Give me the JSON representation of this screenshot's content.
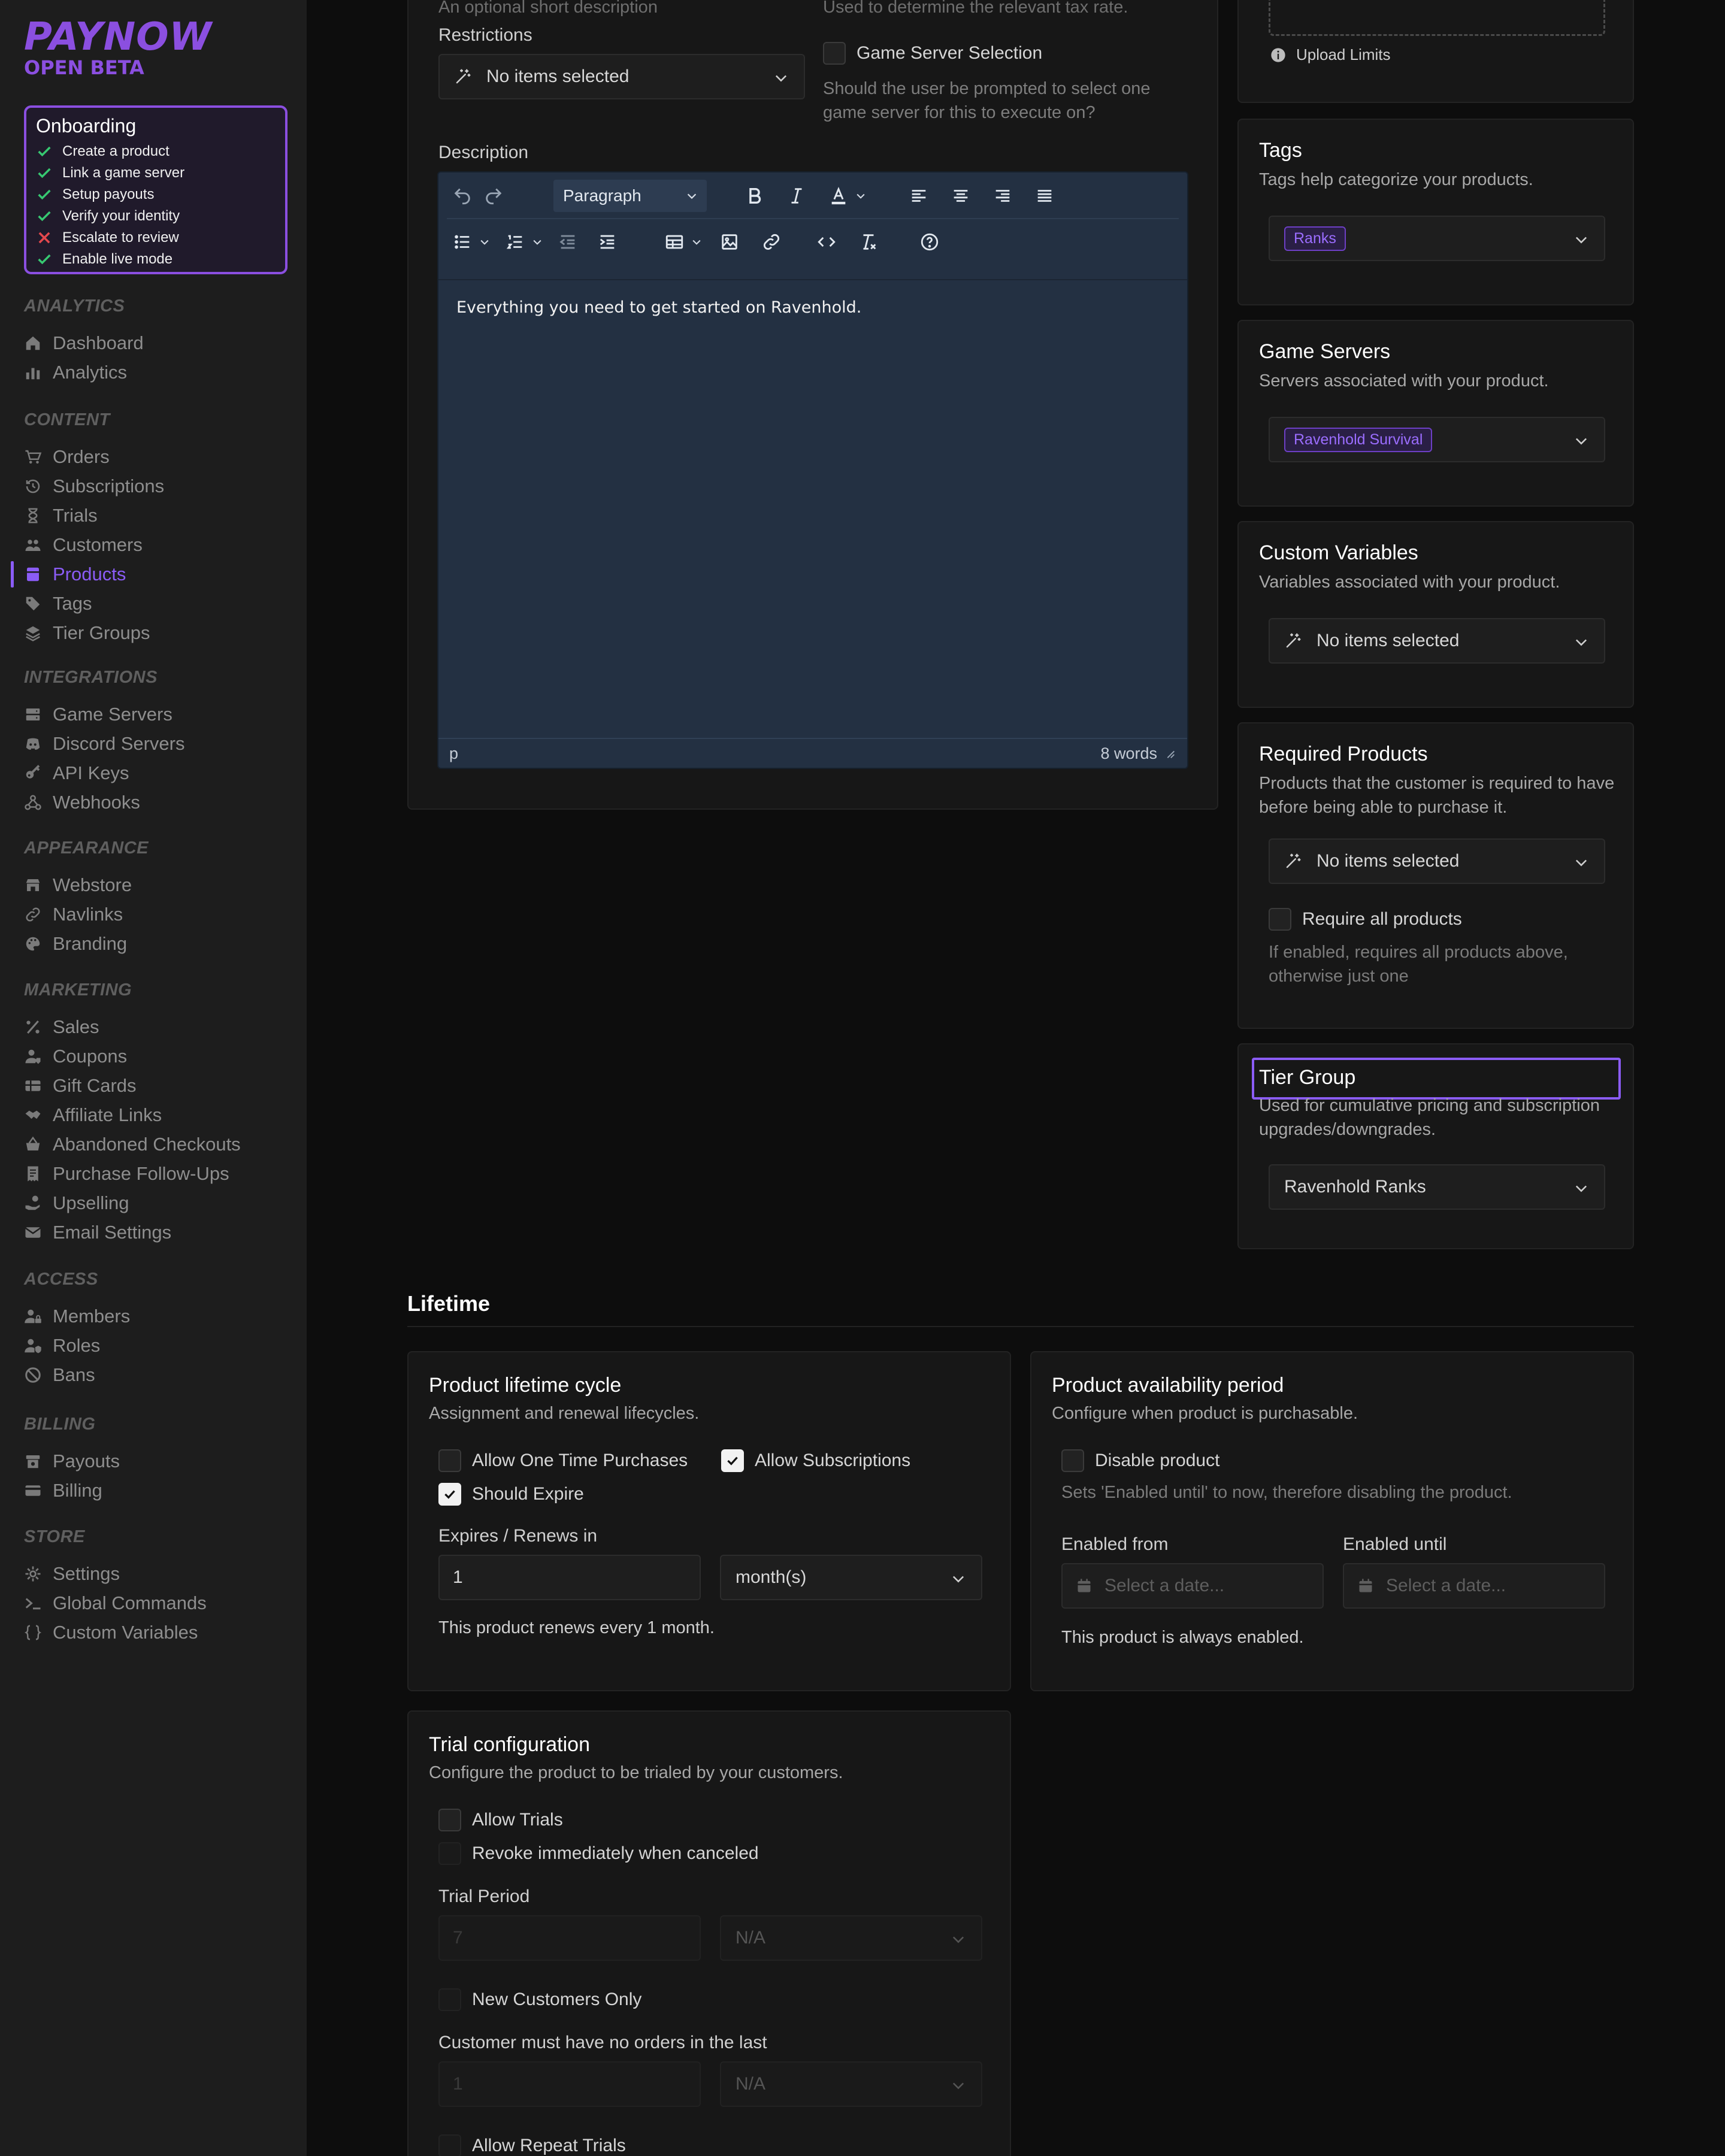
{
  "brand": {
    "name": "PAYNOW",
    "subtitle": "OPEN BETA"
  },
  "onboarding": {
    "title": "Onboarding",
    "items": [
      {
        "label": "Create a product",
        "status": "done"
      },
      {
        "label": "Link a game server",
        "status": "done"
      },
      {
        "label": "Setup payouts",
        "status": "done"
      },
      {
        "label": "Verify your identity",
        "status": "done"
      },
      {
        "label": "Escalate to review",
        "status": "failed"
      },
      {
        "label": "Enable live mode",
        "status": "done"
      }
    ]
  },
  "sidebar": {
    "sections": [
      {
        "title": "ANALYTICS",
        "items": [
          {
            "label": "Dashboard",
            "icon": "home-icon"
          },
          {
            "label": "Analytics",
            "icon": "bar-chart-icon"
          }
        ]
      },
      {
        "title": "CONTENT",
        "items": [
          {
            "label": "Orders",
            "icon": "cart-icon"
          },
          {
            "label": "Subscriptions",
            "icon": "history-icon"
          },
          {
            "label": "Trials",
            "icon": "hourglass-icon"
          },
          {
            "label": "Customers",
            "icon": "users-icon"
          },
          {
            "label": "Products",
            "icon": "box-icon",
            "active": true
          },
          {
            "label": "Tags",
            "icon": "tags-icon"
          },
          {
            "label": "Tier Groups",
            "icon": "layers-icon"
          }
        ]
      },
      {
        "title": "INTEGRATIONS",
        "items": [
          {
            "label": "Game Servers",
            "icon": "server-icon"
          },
          {
            "label": "Discord Servers",
            "icon": "discord-icon"
          },
          {
            "label": "API Keys",
            "icon": "key-icon"
          },
          {
            "label": "Webhooks",
            "icon": "webhook-icon"
          }
        ]
      },
      {
        "title": "APPEARANCE",
        "items": [
          {
            "label": "Webstore",
            "icon": "store-icon"
          },
          {
            "label": "Navlinks",
            "icon": "link-icon"
          },
          {
            "label": "Branding",
            "icon": "palette-icon"
          }
        ]
      },
      {
        "title": "MARKETING",
        "items": [
          {
            "label": "Sales",
            "icon": "percent-icon"
          },
          {
            "label": "Coupons",
            "icon": "user-tag-icon"
          },
          {
            "label": "Gift Cards",
            "icon": "gift-card-icon"
          },
          {
            "label": "Affiliate Links",
            "icon": "handshake-icon"
          },
          {
            "label": "Abandoned Checkouts",
            "icon": "basket-icon"
          },
          {
            "label": "Purchase Follow-Ups",
            "icon": "receipt-icon"
          },
          {
            "label": "Upselling",
            "icon": "hand-coin-icon"
          },
          {
            "label": "Email Settings",
            "icon": "envelope-icon"
          }
        ]
      },
      {
        "title": "ACCESS",
        "items": [
          {
            "label": "Members",
            "icon": "user-lock-icon"
          },
          {
            "label": "Roles",
            "icon": "user-shield-icon"
          },
          {
            "label": "Bans",
            "icon": "ban-icon"
          }
        ]
      },
      {
        "title": "BILLING",
        "items": [
          {
            "label": "Payouts",
            "icon": "payout-icon"
          },
          {
            "label": "Billing",
            "icon": "billing-icon"
          }
        ]
      },
      {
        "title": "STORE",
        "items": [
          {
            "label": "Settings",
            "icon": "gear-icon"
          },
          {
            "label": "Global Commands",
            "icon": "terminal-icon"
          },
          {
            "label": "Custom Variables",
            "icon": "braces-icon"
          }
        ]
      }
    ]
  },
  "general": {
    "short_description_hint": "An optional short description",
    "tax_hint": "Used to determine the relevant tax rate.",
    "restrictions": {
      "label": "Restrictions",
      "value": "No items selected"
    },
    "game_server_selection": {
      "label": "Game Server Selection",
      "hint": "Should the user be prompted to select one game server for this to execute on?",
      "checked": false
    },
    "description_label": "Description"
  },
  "editor": {
    "block_format": "Paragraph",
    "content": "Everything you need to get started on Ravenhold.",
    "status_path": "p",
    "word_count": "8 words"
  },
  "right_panels": {
    "upload_limits": "Upload Limits",
    "tags": {
      "title": "Tags",
      "desc": "Tags help categorize your products.",
      "chips": [
        "Ranks"
      ]
    },
    "game_servers": {
      "title": "Game Servers",
      "desc": "Servers associated with your product.",
      "chips": [
        "Ravenhold Survival"
      ]
    },
    "custom_variables": {
      "title": "Custom Variables",
      "desc": "Variables associated with your product.",
      "value": "No items selected"
    },
    "required_products": {
      "title": "Required Products",
      "desc": "Products that the customer is required to have before being able to purchase it.",
      "value": "No items selected",
      "require_all_label": "Require all products",
      "require_all_hint": "If enabled, requires all products above, otherwise just one"
    },
    "tier_group": {
      "title": "Tier Group",
      "desc": "Used for cumulative pricing and subscription upgrades/downgrades.",
      "value": "Ravenhold Ranks"
    }
  },
  "lifetime": {
    "heading": "Lifetime",
    "cycle": {
      "title": "Product lifetime cycle",
      "desc": "Assignment and renewal lifecycles.",
      "one_time": {
        "label": "Allow One Time Purchases",
        "checked": false
      },
      "subscriptions": {
        "label": "Allow Subscriptions",
        "checked": true
      },
      "should_expire": {
        "label": "Should Expire",
        "checked": true
      },
      "expires_label": "Expires / Renews in",
      "expires_value": "1",
      "expires_unit": "month(s)",
      "summary": "This product renews every 1 month."
    },
    "availability": {
      "title": "Product availability period",
      "desc": "Configure when product is purchasable.",
      "disable": {
        "label": "Disable product",
        "checked": false
      },
      "disable_hint": "Sets 'Enabled until' to now, therefore disabling the product.",
      "from_label": "Enabled from",
      "until_label": "Enabled until",
      "date_placeholder": "Select a date...",
      "summary": "This product is always enabled."
    },
    "trial": {
      "title": "Trial configuration",
      "desc": "Configure the product to be trialed by your customers.",
      "allow_trials": {
        "label": "Allow Trials",
        "checked": false
      },
      "revoke": {
        "label": "Revoke immediately when canceled"
      },
      "period_label": "Trial Period",
      "period_value": "7",
      "period_unit": "N/A",
      "new_customers": {
        "label": "New Customers Only"
      },
      "no_orders_label": "Customer must have no orders in the last",
      "no_orders_value": "1",
      "no_orders_unit": "N/A",
      "repeat": {
        "label": "Allow Repeat Trials"
      }
    }
  }
}
